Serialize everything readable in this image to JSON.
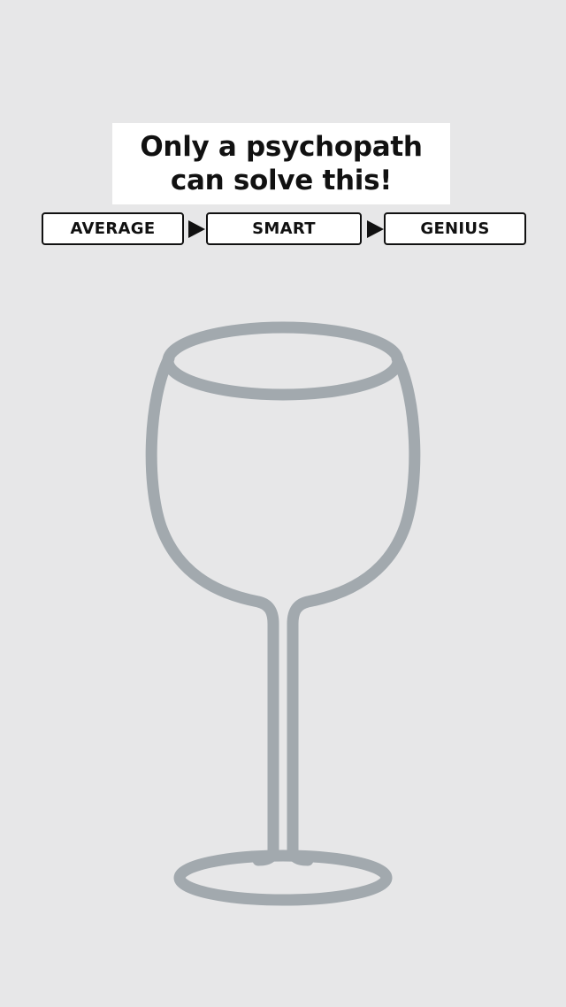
{
  "title": {
    "line1": "Only a psychopath",
    "line2": "can solve this!"
  },
  "levels": [
    {
      "label": "AVERAGE"
    },
    {
      "label": "SMART"
    },
    {
      "label": "GENIUS"
    }
  ],
  "colors": {
    "background": "#e7e7e8",
    "glass_outline": "#a2a9ae",
    "text": "#111111",
    "card": "#ffffff"
  },
  "illustration": {
    "icon": "wine-glass-icon"
  }
}
